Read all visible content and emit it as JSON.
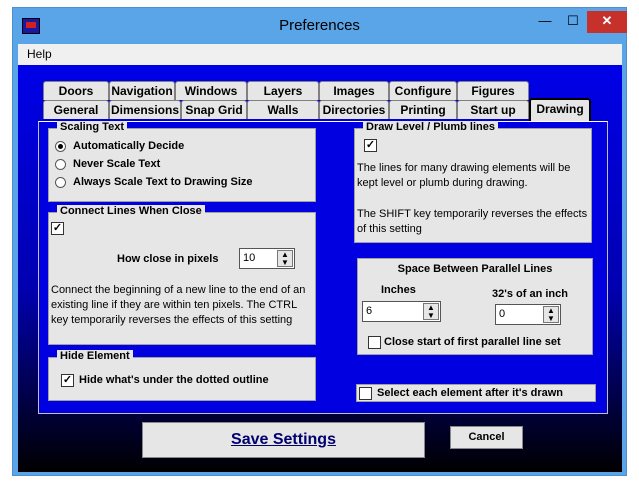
{
  "window": {
    "title": "Preferences",
    "minimize": "—",
    "maximize": "☐",
    "close": "✕"
  },
  "menu": {
    "help": "Help"
  },
  "tabs": {
    "row1": [
      "Doors",
      "Navigation",
      "Windows",
      "Layers",
      "Images",
      "Configure",
      "Figures"
    ],
    "row2": [
      "General",
      "Dimensions",
      "Snap Grid",
      "Walls",
      "Directories",
      "Printing",
      "Start up",
      "Drawing"
    ],
    "active": "Drawing"
  },
  "scaling": {
    "label": "Scaling Text",
    "options": [
      "Automatically Decide",
      "Never Scale Text",
      "Always Scale Text to Drawing Size"
    ],
    "selected": 0
  },
  "connect": {
    "label": "Connect Lines When Close",
    "checked": "✓",
    "pixels_label": "How close in pixels",
    "pixels_value": "10",
    "desc": "Connect the beginning of a new line to the end of an existing line if they are within ten pixels. The CTRL key temporarily reverses the effects of this setting"
  },
  "hide": {
    "label": "Hide Element",
    "checked": "✓",
    "option": "Hide what's under the dotted outline"
  },
  "draw_level": {
    "label": "Draw Level / Plumb lines",
    "checked": "✓",
    "desc1": "The lines for many drawing elements will be kept level or plumb during drawing.",
    "desc2": "The SHIFT key temporarily reverses the effects of this setting"
  },
  "parallel": {
    "label": "Space Between Parallel Lines",
    "inches_label": "Inches",
    "inches_value": "6",
    "frac_label": "32's of an inch",
    "frac_value": "0",
    "close_start": "Close start of first parallel line set"
  },
  "select_each": "Select each element after it's drawn",
  "buttons": {
    "save": "Save Settings",
    "cancel": "Cancel"
  },
  "icons": [
    "app-icon",
    "spin-icon"
  ]
}
